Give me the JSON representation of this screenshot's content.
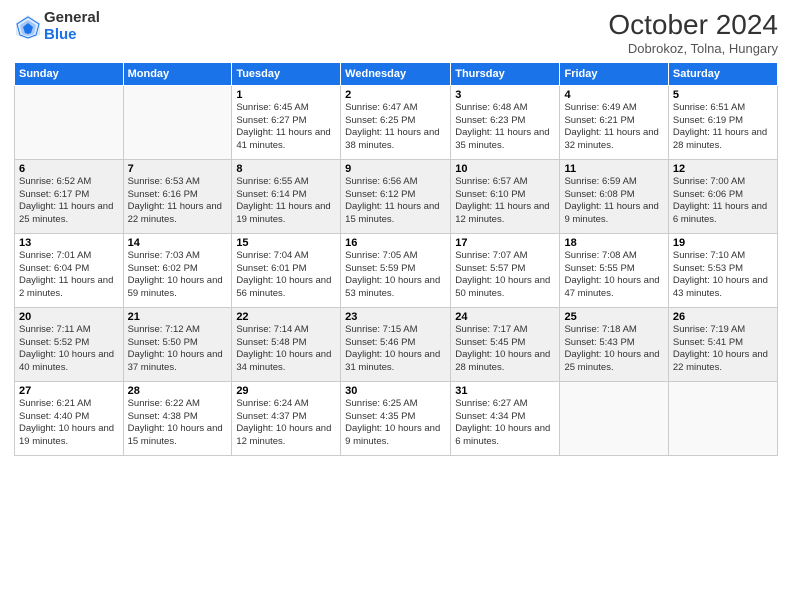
{
  "header": {
    "logo_general": "General",
    "logo_blue": "Blue",
    "main_title": "October 2024",
    "subtitle": "Dobrokoz, Tolna, Hungary"
  },
  "days_of_week": [
    "Sunday",
    "Monday",
    "Tuesday",
    "Wednesday",
    "Thursday",
    "Friday",
    "Saturday"
  ],
  "weeks": [
    {
      "shaded": false,
      "days": [
        {
          "num": "",
          "detail": ""
        },
        {
          "num": "",
          "detail": ""
        },
        {
          "num": "1",
          "detail": "Sunrise: 6:45 AM\nSunset: 6:27 PM\nDaylight: 11 hours and 41 minutes."
        },
        {
          "num": "2",
          "detail": "Sunrise: 6:47 AM\nSunset: 6:25 PM\nDaylight: 11 hours and 38 minutes."
        },
        {
          "num": "3",
          "detail": "Sunrise: 6:48 AM\nSunset: 6:23 PM\nDaylight: 11 hours and 35 minutes."
        },
        {
          "num": "4",
          "detail": "Sunrise: 6:49 AM\nSunset: 6:21 PM\nDaylight: 11 hours and 32 minutes."
        },
        {
          "num": "5",
          "detail": "Sunrise: 6:51 AM\nSunset: 6:19 PM\nDaylight: 11 hours and 28 minutes."
        }
      ]
    },
    {
      "shaded": true,
      "days": [
        {
          "num": "6",
          "detail": "Sunrise: 6:52 AM\nSunset: 6:17 PM\nDaylight: 11 hours and 25 minutes."
        },
        {
          "num": "7",
          "detail": "Sunrise: 6:53 AM\nSunset: 6:16 PM\nDaylight: 11 hours and 22 minutes."
        },
        {
          "num": "8",
          "detail": "Sunrise: 6:55 AM\nSunset: 6:14 PM\nDaylight: 11 hours and 19 minutes."
        },
        {
          "num": "9",
          "detail": "Sunrise: 6:56 AM\nSunset: 6:12 PM\nDaylight: 11 hours and 15 minutes."
        },
        {
          "num": "10",
          "detail": "Sunrise: 6:57 AM\nSunset: 6:10 PM\nDaylight: 11 hours and 12 minutes."
        },
        {
          "num": "11",
          "detail": "Sunrise: 6:59 AM\nSunset: 6:08 PM\nDaylight: 11 hours and 9 minutes."
        },
        {
          "num": "12",
          "detail": "Sunrise: 7:00 AM\nSunset: 6:06 PM\nDaylight: 11 hours and 6 minutes."
        }
      ]
    },
    {
      "shaded": false,
      "days": [
        {
          "num": "13",
          "detail": "Sunrise: 7:01 AM\nSunset: 6:04 PM\nDaylight: 11 hours and 2 minutes."
        },
        {
          "num": "14",
          "detail": "Sunrise: 7:03 AM\nSunset: 6:02 PM\nDaylight: 10 hours and 59 minutes."
        },
        {
          "num": "15",
          "detail": "Sunrise: 7:04 AM\nSunset: 6:01 PM\nDaylight: 10 hours and 56 minutes."
        },
        {
          "num": "16",
          "detail": "Sunrise: 7:05 AM\nSunset: 5:59 PM\nDaylight: 10 hours and 53 minutes."
        },
        {
          "num": "17",
          "detail": "Sunrise: 7:07 AM\nSunset: 5:57 PM\nDaylight: 10 hours and 50 minutes."
        },
        {
          "num": "18",
          "detail": "Sunrise: 7:08 AM\nSunset: 5:55 PM\nDaylight: 10 hours and 47 minutes."
        },
        {
          "num": "19",
          "detail": "Sunrise: 7:10 AM\nSunset: 5:53 PM\nDaylight: 10 hours and 43 minutes."
        }
      ]
    },
    {
      "shaded": true,
      "days": [
        {
          "num": "20",
          "detail": "Sunrise: 7:11 AM\nSunset: 5:52 PM\nDaylight: 10 hours and 40 minutes."
        },
        {
          "num": "21",
          "detail": "Sunrise: 7:12 AM\nSunset: 5:50 PM\nDaylight: 10 hours and 37 minutes."
        },
        {
          "num": "22",
          "detail": "Sunrise: 7:14 AM\nSunset: 5:48 PM\nDaylight: 10 hours and 34 minutes."
        },
        {
          "num": "23",
          "detail": "Sunrise: 7:15 AM\nSunset: 5:46 PM\nDaylight: 10 hours and 31 minutes."
        },
        {
          "num": "24",
          "detail": "Sunrise: 7:17 AM\nSunset: 5:45 PM\nDaylight: 10 hours and 28 minutes."
        },
        {
          "num": "25",
          "detail": "Sunrise: 7:18 AM\nSunset: 5:43 PM\nDaylight: 10 hours and 25 minutes."
        },
        {
          "num": "26",
          "detail": "Sunrise: 7:19 AM\nSunset: 5:41 PM\nDaylight: 10 hours and 22 minutes."
        }
      ]
    },
    {
      "shaded": false,
      "days": [
        {
          "num": "27",
          "detail": "Sunrise: 6:21 AM\nSunset: 4:40 PM\nDaylight: 10 hours and 19 minutes."
        },
        {
          "num": "28",
          "detail": "Sunrise: 6:22 AM\nSunset: 4:38 PM\nDaylight: 10 hours and 15 minutes."
        },
        {
          "num": "29",
          "detail": "Sunrise: 6:24 AM\nSunset: 4:37 PM\nDaylight: 10 hours and 12 minutes."
        },
        {
          "num": "30",
          "detail": "Sunrise: 6:25 AM\nSunset: 4:35 PM\nDaylight: 10 hours and 9 minutes."
        },
        {
          "num": "31",
          "detail": "Sunrise: 6:27 AM\nSunset: 4:34 PM\nDaylight: 10 hours and 6 minutes."
        },
        {
          "num": "",
          "detail": ""
        },
        {
          "num": "",
          "detail": ""
        }
      ]
    }
  ]
}
